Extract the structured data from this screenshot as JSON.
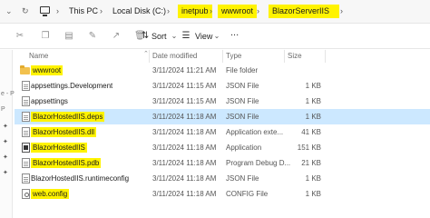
{
  "address": {
    "crumbs": [
      "This PC",
      "Local Disk (C:)",
      "inetpub",
      "wwwroot",
      "BlazorServerIIS"
    ]
  },
  "toolbar": {
    "sort_label": "Sort",
    "view_label": "View",
    "more_label": "..."
  },
  "columns": {
    "name": "Name",
    "date": "Date modified",
    "type": "Type",
    "size": "Size"
  },
  "leftpane": {
    "items": [
      "e - P",
      "P"
    ]
  },
  "files": [
    {
      "name": "wwwroot",
      "date": "3/11/2024 11:21 AM",
      "type": "File folder",
      "size": "",
      "icon": "folder-icon",
      "highlight": true,
      "selected": false
    },
    {
      "name": "appsettings.Development",
      "date": "3/11/2024 11:15 AM",
      "type": "JSON File",
      "size": "1 KB",
      "icon": "json-file-icon",
      "highlight": false,
      "selected": false
    },
    {
      "name": "appsettings",
      "date": "3/11/2024 11:15 AM",
      "type": "JSON File",
      "size": "1 KB",
      "icon": "json-file-icon",
      "highlight": false,
      "selected": false
    },
    {
      "name": "BlazorHostedIIS.deps",
      "date": "3/11/2024 11:18 AM",
      "type": "JSON File",
      "size": "1 KB",
      "icon": "json-file-icon",
      "highlight": true,
      "selected": true
    },
    {
      "name": "BlazorHostedIIS.dll",
      "date": "3/11/2024 11:18 AM",
      "type": "Application exte...",
      "size": "41 KB",
      "icon": "dll-file-icon",
      "highlight": true,
      "selected": false
    },
    {
      "name": "BlazorHostedIIS",
      "date": "3/11/2024 11:18 AM",
      "type": "Application",
      "size": "151 KB",
      "icon": "application-icon",
      "highlight": true,
      "selected": false
    },
    {
      "name": "BlazorHostedIIS.pdb",
      "date": "3/11/2024 11:18 AM",
      "type": "Program Debug D...",
      "size": "21 KB",
      "icon": "pdb-file-icon",
      "highlight": true,
      "selected": false
    },
    {
      "name": "BlazorHostedIIS.runtimeconfig",
      "date": "3/11/2024 11:18 AM",
      "type": "JSON File",
      "size": "1 KB",
      "icon": "json-file-icon",
      "highlight": false,
      "selected": false
    },
    {
      "name": "web.config",
      "date": "3/11/2024 11:18 AM",
      "type": "CONFIG File",
      "size": "1 KB",
      "icon": "config-file-icon",
      "highlight": true,
      "selected": false
    }
  ],
  "colors": {
    "highlight": "#fff300",
    "selection": "#cce8ff"
  }
}
